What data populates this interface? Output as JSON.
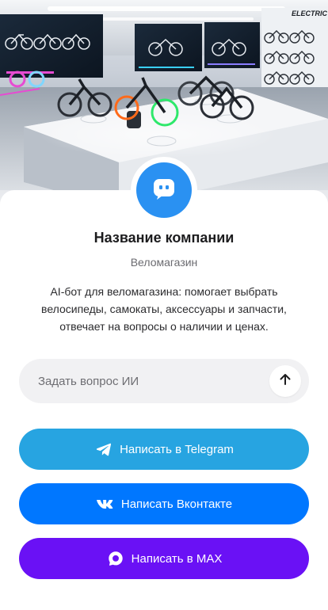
{
  "hero": {
    "storefront_sign": "ELECTRIC"
  },
  "company": {
    "name": "Название компании",
    "category": "Веломагазин",
    "description": "AI-бот для веломагазина: помогает выбрать велосипеды, самокаты, аксессуары и запчасти, отвечает на вопросы о наличии и ценах.",
    "avatar_icon": "chat-bot-icon"
  },
  "ask": {
    "placeholder": "Задать вопрос ИИ",
    "value": "",
    "send_icon": "arrow-up-icon"
  },
  "actions": [
    {
      "label": "Написать в Telegram",
      "icon": "telegram-icon",
      "color": "#27a4e1"
    },
    {
      "label": "Написать Вконтакте",
      "icon": "vk-icon",
      "color": "#0077ff"
    },
    {
      "label": "Написать в MAX",
      "icon": "max-icon",
      "color": "#6a11f5"
    }
  ],
  "colors": {
    "avatar": "#2a91f2",
    "input_bg": "#f1f1f3",
    "title": "#1c1c1e",
    "muted": "#6b6b70"
  }
}
